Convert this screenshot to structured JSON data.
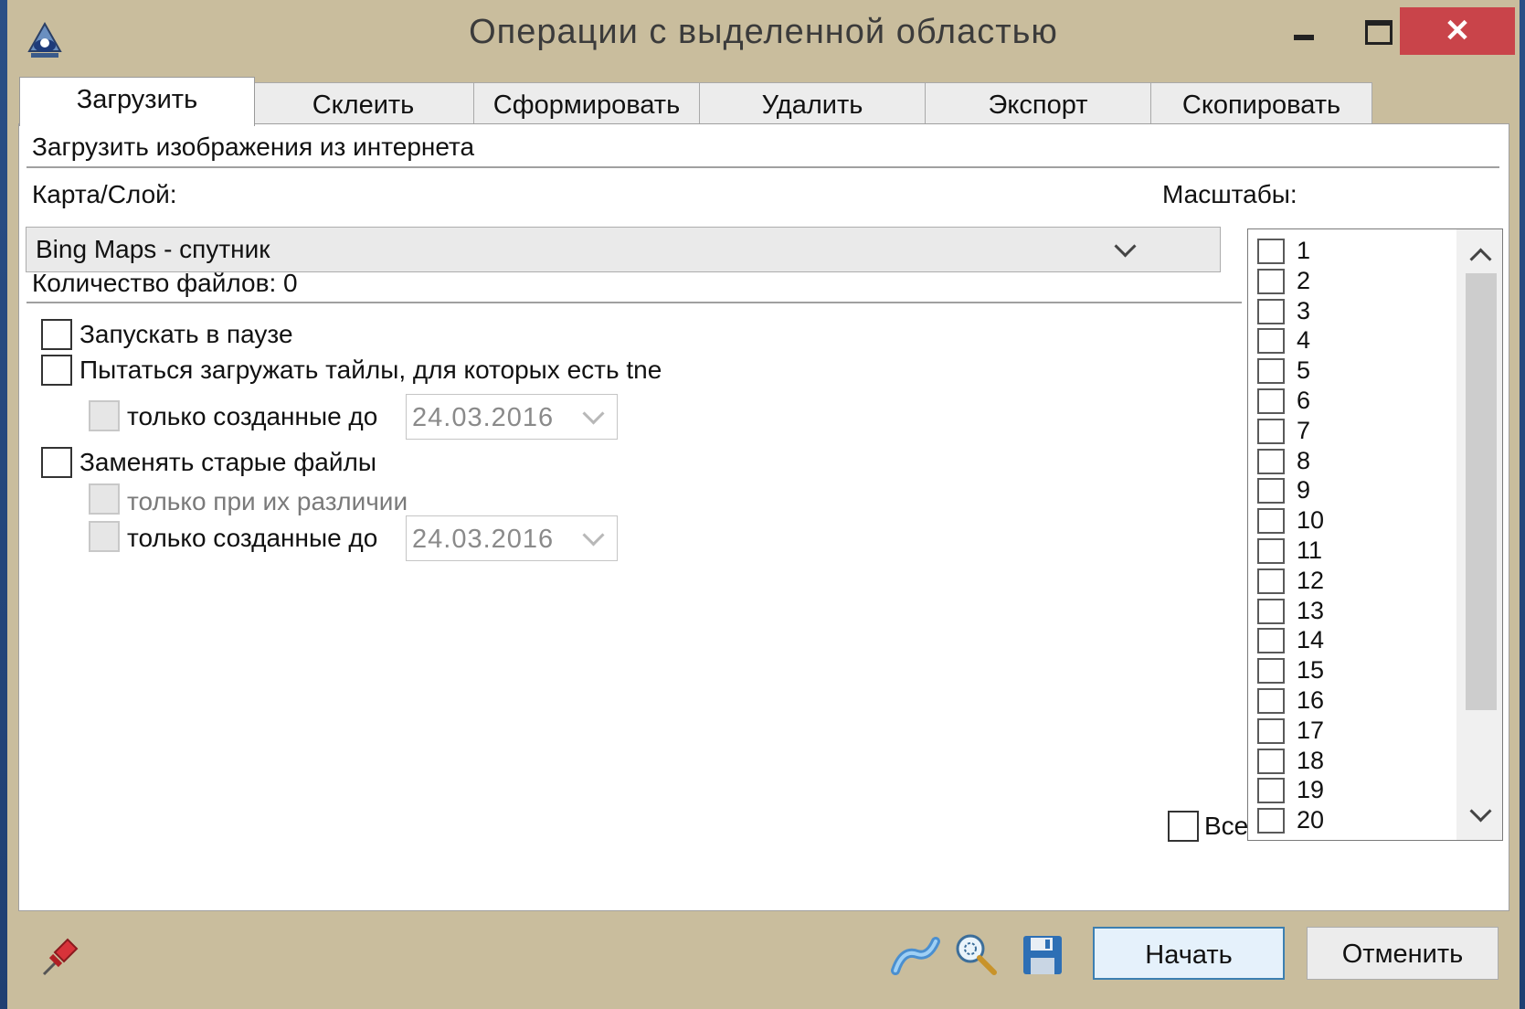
{
  "window": {
    "title": "Операции с выделенной областью",
    "close_glyph": "✕",
    "minimize_icon": "minimize-icon",
    "maximize_icon": "maximize-icon"
  },
  "tabs": [
    {
      "label": "Загрузить",
      "active": true
    },
    {
      "label": "Склеить",
      "active": false
    },
    {
      "label": "Сформировать",
      "active": false
    },
    {
      "label": "Удалить",
      "active": false
    },
    {
      "label": "Экспорт",
      "active": false
    },
    {
      "label": "Скопировать",
      "active": false
    }
  ],
  "download": {
    "header": "Загрузить изображения из интернета",
    "map_layer_label": "Карта/Слой:",
    "map_layer_value": "Bing Maps - спутник",
    "file_count_text": "Количество файлов: 0",
    "start_paused_label": "Запускать в паузе",
    "try_tne_label": "Пытаться загружать тайлы, для которых есть tne",
    "only_created_before_label": "только созданные до",
    "tne_date": "24.03.2016",
    "replace_old_label": "Заменять старые файлы",
    "only_if_different_label": "только при их различии",
    "replace_date": "24.03.2016"
  },
  "scales": {
    "label": "Масштабы:",
    "items": [
      "1",
      "2",
      "3",
      "4",
      "5",
      "6",
      "7",
      "8",
      "9",
      "10",
      "11",
      "12",
      "13",
      "14",
      "15",
      "16",
      "17",
      "18",
      "19",
      "20"
    ],
    "all_label": "Все"
  },
  "footer": {
    "start_button": "Начать",
    "cancel_button": "Отменить",
    "icons": [
      "pin-icon",
      "map-link-icon",
      "zoom-search-icon",
      "save-icon"
    ]
  },
  "colors": {
    "frame": "#c9bd9d",
    "close": "#c9444a",
    "primary_border": "#3c7fb1",
    "desktop": "#2a4f86"
  }
}
